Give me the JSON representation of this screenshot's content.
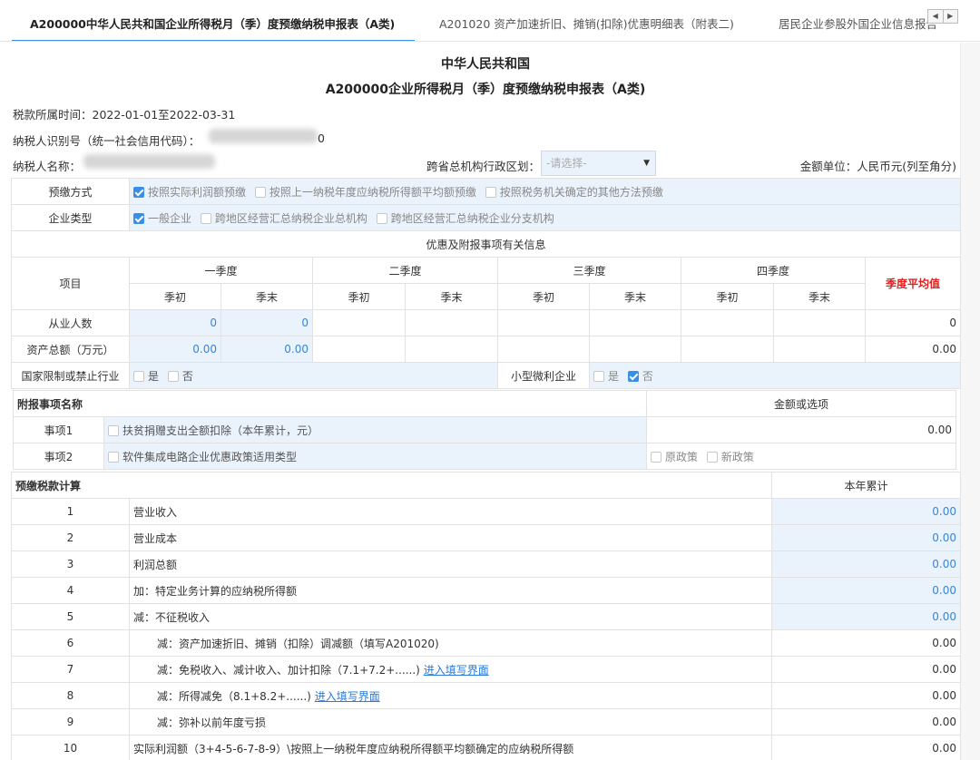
{
  "tabs": [
    {
      "label": "A200000中华人民共和国企业所得税月（季）度预缴纳税申报表（A类)"
    },
    {
      "label": "A201020 资产加速折旧、摊销(扣除)优惠明细表（附表二)"
    },
    {
      "label": "居民企业参股外国企业信息报告"
    }
  ],
  "header": {
    "title1": "中华人民共和国",
    "title2": "A200000企业所得税月（季）度预缴纳税申报表（A类)",
    "period": "税款所属时间：2022-01-01至2022-03-31",
    "taxpayer_id_label": "纳税人识别号（统一社会信用代码）：",
    "taxpayer_id_tail": "0",
    "taxpayer_name_label": "纳税人名称：",
    "region_label": "跨省总机构行政区划：",
    "region_placeholder": "-请选择-",
    "unit": "金额单位：人民币元(列至角分)"
  },
  "basic": {
    "prepay_label": "预缴方式",
    "prepay_options": [
      {
        "label": "按照实际利润额预缴",
        "checked": true
      },
      {
        "label": "按照上一纳税年度应纳税所得额平均额预缴",
        "checked": false
      },
      {
        "label": "按照税务机关确定的其他方法预缴",
        "checked": false
      }
    ],
    "type_label": "企业类型",
    "type_options": [
      {
        "label": "一般企业",
        "checked": true
      },
      {
        "label": "跨地区经营汇总纳税企业总机构",
        "checked": false
      },
      {
        "label": "跨地区经营汇总纳税企业分支机构",
        "checked": false
      }
    ]
  },
  "pref": {
    "section_title": "优惠及附报事项有关信息",
    "item_label": "项目",
    "q1": "一季度",
    "q2": "二季度",
    "q3": "三季度",
    "q4": "四季度",
    "start": "季初",
    "end": "季末",
    "avg": "季度平均值",
    "employees_label": "从业人数",
    "employees_q1_start": "0",
    "employees_q1_end": "0",
    "employees_avg": "0",
    "assets_label": "资产总额（万元）",
    "assets_q1_start": "0.00",
    "assets_q1_end": "0.00",
    "assets_avg": "0.00",
    "restricted_label": "国家限制或禁止行业",
    "yes": "是",
    "no": "否",
    "small_label": "小型微利企业"
  },
  "attach": {
    "name_header": "附报事项名称",
    "value_header": "金额或选项",
    "item1_label": "事项1",
    "item1_text": "扶贫捐赠支出全额扣除（本年累计，元）",
    "item1_value": "0.00",
    "item2_label": "事项2",
    "item2_text": "软件集成电路企业优惠政策适用类型",
    "item2_opt1": "原政策",
    "item2_opt2": "新政策"
  },
  "calc": {
    "header": "预缴税款计算",
    "value_header": "本年累计",
    "link_text": "进入填写界面",
    "rows": [
      {
        "no": "1",
        "text": "营业收入",
        "value": "0.00"
      },
      {
        "no": "2",
        "text": "营业成本",
        "value": "0.00"
      },
      {
        "no": "3",
        "text": "利润总额",
        "value": "0.00"
      },
      {
        "no": "4",
        "text": "加：特定业务计算的应纳税所得额",
        "value": "0.00"
      },
      {
        "no": "5",
        "text": "减：不征税收入",
        "value": "0.00"
      },
      {
        "no": "6",
        "text": "减：资产加速折旧、摊销（扣除）调减额（填写A201020)",
        "value": "0.00"
      },
      {
        "no": "7",
        "text": "减：免税收入、减计收入、加计扣除（7.1+7.2+......)",
        "value": "0.00"
      },
      {
        "no": "8",
        "text": "减：所得减免（8.1+8.2+......)",
        "value": "0.00"
      },
      {
        "no": "9",
        "text": "减：弥补以前年度亏损",
        "value": "0.00"
      },
      {
        "no": "10",
        "text": "实际利润额（3+4-5-6-7-8-9）\\按照上一纳税年度应纳税所得额平均额确定的应纳税所得额",
        "value": "0.00"
      }
    ]
  }
}
